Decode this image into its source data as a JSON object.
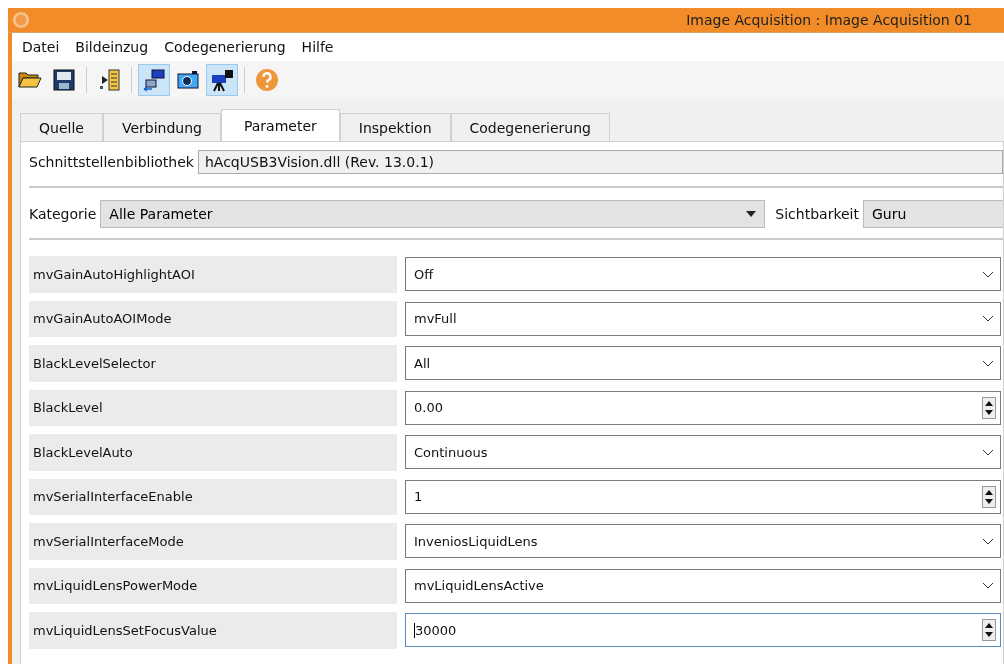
{
  "window": {
    "title": "Image Acquisition : Image Acquisition 01"
  },
  "menu": [
    "Datei",
    "Bildeinzug",
    "Codegenerierung",
    "Hilfe"
  ],
  "toolbar": [
    {
      "kind": "open",
      "pressed": false
    },
    {
      "kind": "save",
      "pressed": false
    },
    {
      "kind": "separator"
    },
    {
      "kind": "export",
      "pressed": false
    },
    {
      "kind": "separator"
    },
    {
      "kind": "connect",
      "pressed": true
    },
    {
      "kind": "snap",
      "pressed": false
    },
    {
      "kind": "live",
      "pressed": true
    },
    {
      "kind": "separator"
    },
    {
      "kind": "help",
      "pressed": false
    }
  ],
  "tabs": [
    {
      "label": "Quelle",
      "selected": false
    },
    {
      "label": "Verbindung",
      "selected": false
    },
    {
      "label": "Parameter",
      "selected": true
    },
    {
      "label": "Inspektion",
      "selected": false
    },
    {
      "label": "Codegenerierung",
      "selected": false
    }
  ],
  "interface_library": {
    "label": "Schnittstellenbibliothek",
    "value": "hAcqUSB3Vision.dll (Rev. 13.0.1)"
  },
  "category": {
    "label": "Kategorie",
    "value": "Alle Parameter"
  },
  "visibility": {
    "label": "Sichtbarkeit",
    "value": "Guru"
  },
  "parameters": [
    {
      "name": "mvGainAutoHighlightAOI",
      "kind": "dropdown",
      "value": "Off",
      "focused": false
    },
    {
      "name": "mvGainAutoAOIMode",
      "kind": "dropdown",
      "value": "mvFull",
      "focused": false
    },
    {
      "name": "BlackLevelSelector",
      "kind": "dropdown",
      "value": "All",
      "focused": false
    },
    {
      "name": "BlackLevel",
      "kind": "spin",
      "value": "0.00",
      "focused": false
    },
    {
      "name": "BlackLevelAuto",
      "kind": "dropdown",
      "value": "Continuous",
      "focused": false
    },
    {
      "name": "mvSerialInterfaceEnable",
      "kind": "spin",
      "value": "1",
      "focused": false
    },
    {
      "name": "mvSerialInterfaceMode",
      "kind": "dropdown",
      "value": "InveniosLiquidLens",
      "focused": false
    },
    {
      "name": "mvLiquidLensPowerMode",
      "kind": "dropdown",
      "value": "mvLiquidLensActive",
      "focused": false
    },
    {
      "name": "mvLiquidLensSetFocusValue",
      "kind": "spin",
      "value": "30000",
      "focused": true
    }
  ]
}
